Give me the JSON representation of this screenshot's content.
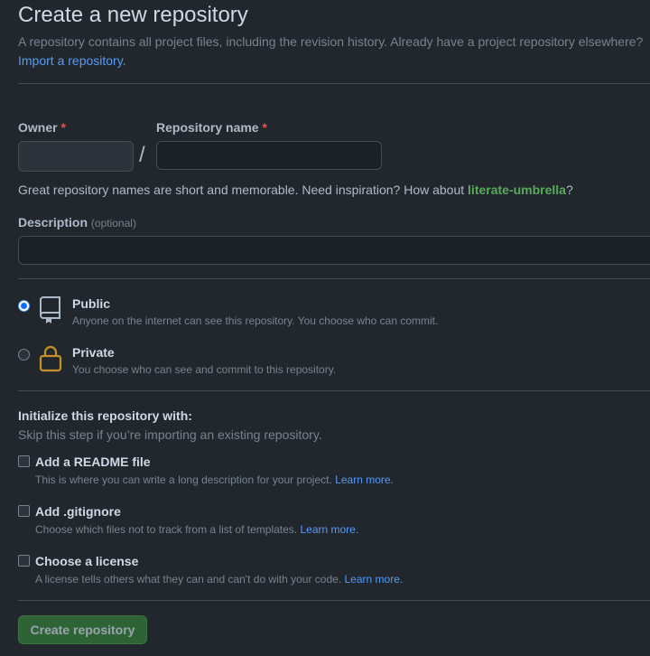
{
  "header": {
    "title": "Create a new repository",
    "subtitle": "A repository contains all project files, including the revision history. Already have a project repository elsewhere?",
    "import_link": "Import a repository."
  },
  "form": {
    "owner_label": "Owner",
    "repo_name_label": "Repository name",
    "required_mark": "*",
    "slash": "/",
    "repo_name_value": "",
    "name_hint_prefix": "Great repository names are short and memorable. Need inspiration? How about ",
    "name_suggestion": "literate-umbrella",
    "name_hint_suffix": "?",
    "description_label": "Description",
    "description_optional": "(optional)",
    "description_value": ""
  },
  "visibility": {
    "public": {
      "title": "Public",
      "description": "Anyone on the internet can see this repository. You choose who can commit.",
      "icon": "repo-icon",
      "selected": true
    },
    "private": {
      "title": "Private",
      "description": "You choose who can see and commit to this repository.",
      "icon": "lock-icon",
      "selected": false
    }
  },
  "initialize": {
    "heading": "Initialize this repository with:",
    "subheading": "Skip this step if you’re importing an existing repository.",
    "options": [
      {
        "title": "Add a README file",
        "description": "This is where you can write a long description for your project.",
        "link": "Learn more.",
        "checked": false
      },
      {
        "title": "Add .gitignore",
        "description": "Choose which files not to track from a list of templates.",
        "link": "Learn more.",
        "checked": false
      },
      {
        "title": "Choose a license",
        "description": "A license tells others what they can and can't do with your code.",
        "link": "Learn more.",
        "checked": false
      }
    ]
  },
  "actions": {
    "create_button": "Create repository"
  },
  "colors": {
    "background": "#22272e",
    "accent_link": "#539bf5",
    "suggestion_green": "#57ab5a",
    "required_red": "#e5534b",
    "lock_yellow": "#c69026",
    "button_green": "#347d39"
  }
}
